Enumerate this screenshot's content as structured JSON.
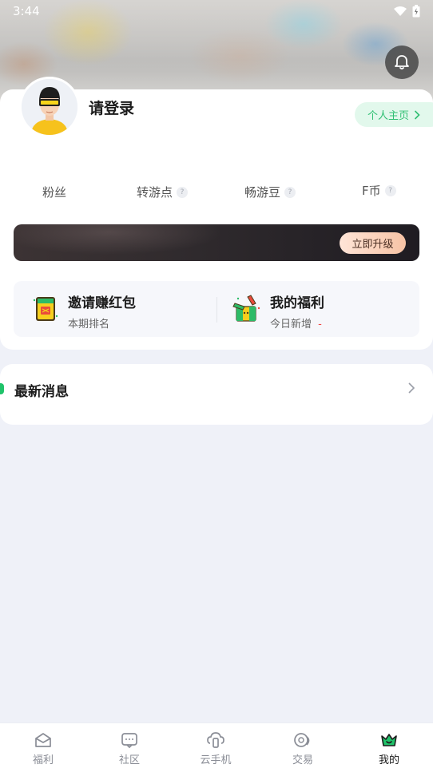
{
  "status_bar": {
    "time": "3:44"
  },
  "profile": {
    "login_prompt": "请登录",
    "home_button": "个人主页",
    "stats": [
      {
        "label": "粉丝",
        "has_help": false
      },
      {
        "label": "转游点",
        "has_help": true
      },
      {
        "label": "畅游豆",
        "has_help": true
      },
      {
        "label": "F币",
        "has_help": true
      }
    ],
    "help_glyph": "?",
    "vip": {
      "upgrade_button": "立即升级"
    },
    "benefits": [
      {
        "title": "邀请赚红包",
        "subtitle": "本期排名"
      },
      {
        "title": "我的福利",
        "subtitle": "今日新增",
        "value": "-"
      }
    ]
  },
  "news": {
    "title": "最新消息"
  },
  "tabbar": {
    "tabs": [
      {
        "label": "福利",
        "icon": "envelope-icon"
      },
      {
        "label": "社区",
        "icon": "community-chat-icon"
      },
      {
        "label": "云手机",
        "icon": "cloud-phone-icon"
      },
      {
        "label": "交易",
        "icon": "trade-icon"
      },
      {
        "label": "我的",
        "icon": "crown-icon",
        "active": true
      }
    ]
  },
  "colors": {
    "accent_green": "#20c36a",
    "home_btn_bg": "#e2f8ec",
    "home_btn_text": "#2fbf72",
    "page_bg": "#eff1f8",
    "vip_bg": "#2f2a2d",
    "upgrade_btn": "#f7c3a5",
    "red_value": "#f04848"
  }
}
